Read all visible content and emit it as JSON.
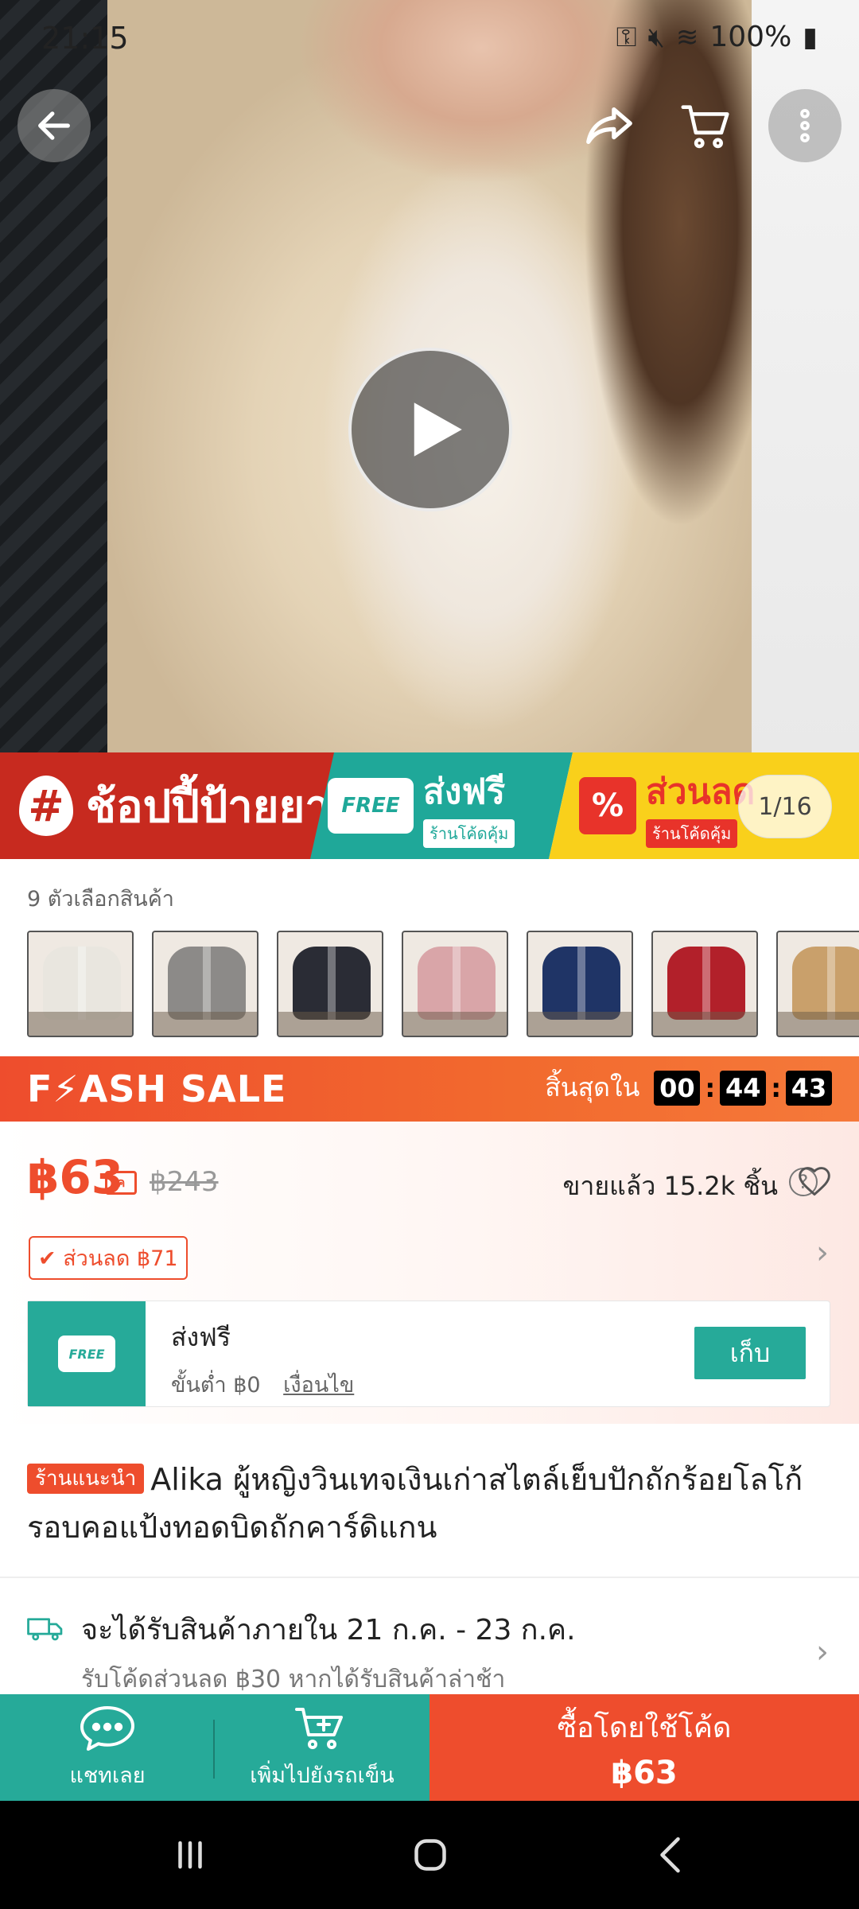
{
  "status_bar": {
    "time": "21:15",
    "battery": "100%"
  },
  "media": {
    "counter": "1/16"
  },
  "promo_banner": {
    "hash_symbol": "#",
    "shoppee_tag": "ช้อปปี้ป้ายยา",
    "free_badge": "FREE",
    "free_shipping": "ส่งฟรี",
    "free_shipping_sub": "ร้านโค้ดคุ้ม",
    "percent_icon": "%",
    "discount": "ส่วนลด",
    "discount_sub": "ร้านโค้ดคุ้ม"
  },
  "variants": {
    "label": "9 ตัวเลือกสินค้า",
    "colors": [
      "#e9e6df",
      "#8c8a88",
      "#2a2c35",
      "#d9a5a8",
      "#1f3466",
      "#b2202a",
      "#c9a06b"
    ]
  },
  "flash_sale": {
    "title": "F⚡ASH SALE",
    "ends_in": "สิ้นสุดใน",
    "hours": "00",
    "minutes": "44",
    "seconds": "43"
  },
  "price": {
    "current": "฿63",
    "coin_icon": "ค",
    "original": "฿243",
    "sold": "ขายแล้ว 15.2k ชิ้น",
    "help": "?",
    "discount_tag": "✔ ส่วนลด ฿71"
  },
  "shipping_voucher": {
    "badge": "FREE",
    "title": "ส่งฟรี",
    "minimum": "ขั้นต่ำ ฿0",
    "conditions": "เงื่อนไข",
    "collect": "เก็บ"
  },
  "product": {
    "badge": "ร้านแนะนำ",
    "title": "Alika ผู้หญิงวินเทจเงินเก่าสไตล์เย็บปักถักร้อยโลโก้รอบคอแป้งทอดบิดถักคาร์ดิแกน"
  },
  "delivery": {
    "estimate": "จะได้รับสินค้าภายใน 21 ก.ค. - 23 ก.ค.",
    "late_voucher": "รับโค้ดส่วนลด ฿30 หากได้รับสินค้าล่าช้า"
  },
  "action_bar": {
    "chat": "แชทเลย",
    "add_to_cart": "เพิ่มไปยังรถเข็น",
    "buy_label": "ซื้อโดยใช้โค้ด",
    "buy_price": "฿63"
  },
  "icons": {
    "back": "arrow-left-icon",
    "share": "share-icon",
    "cart": "cart-icon",
    "more": "more-vertical-icon",
    "play": "play-icon"
  },
  "colors": {
    "brand_orange": "#ee4d2d",
    "teal": "#26aa99"
  }
}
